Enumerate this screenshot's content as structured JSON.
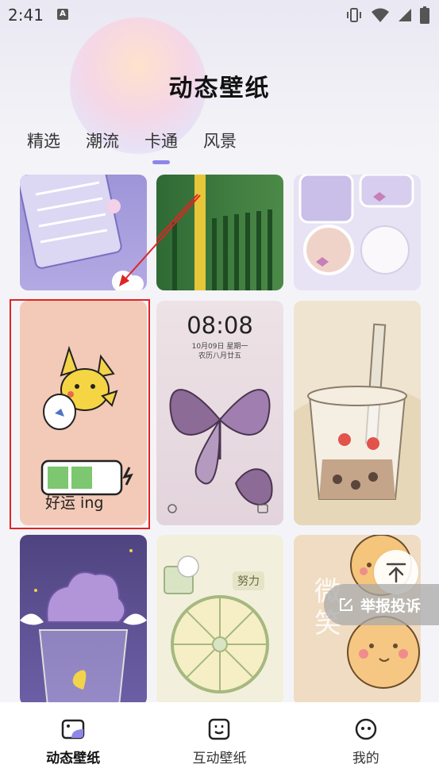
{
  "status_bar": {
    "time": "2:41",
    "notification_icon": "A"
  },
  "app": {
    "title": "动态壁纸"
  },
  "tabs": [
    {
      "label": "精选",
      "active": false
    },
    {
      "label": "潮流",
      "active": false
    },
    {
      "label": "卡通",
      "active": true
    },
    {
      "label": "风景",
      "active": false
    }
  ],
  "wallpapers": {
    "lock_screen": {
      "time": "08:08",
      "date": "10月09日 星期一",
      "lunar": "农历八月廿五"
    },
    "lucky_text": "好运 ing",
    "power_text": "努力",
    "smile_text": "微笑"
  },
  "floating": {
    "report_label": "举报投诉"
  },
  "bottom_nav": [
    {
      "label": "动态壁纸",
      "icon": "wallpaper-icon",
      "active": true
    },
    {
      "label": "互动壁纸",
      "icon": "interactive-icon",
      "active": false
    },
    {
      "label": "我的",
      "icon": "profile-face-icon",
      "active": false
    }
  ],
  "colors": {
    "accent": "#8f86ea",
    "highlight": "#e02424"
  }
}
